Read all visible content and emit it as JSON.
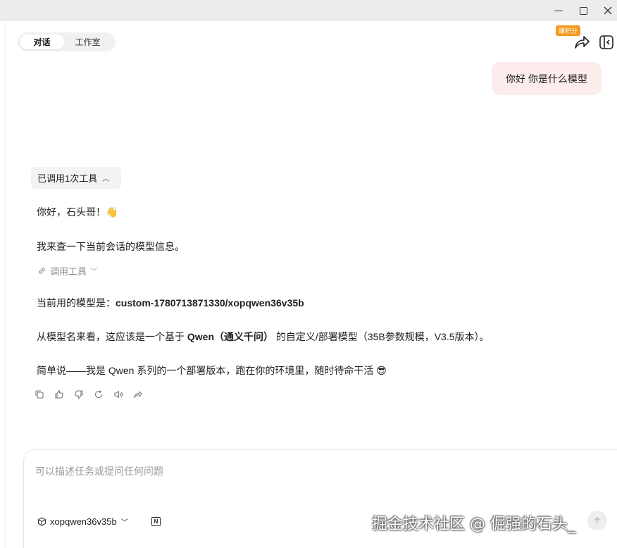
{
  "header": {
    "tabs": [
      {
        "label": "对话",
        "active": true
      },
      {
        "label": "工作室",
        "active": false
      }
    ],
    "earn_badge": "赚积分",
    "icons": {
      "share": "share-icon",
      "sidebar": "sidebar-toggle-icon"
    }
  },
  "window_controls": {
    "minimize": "minimize-icon",
    "maximize": "maximize-icon",
    "close": "close-icon"
  },
  "conversation": {
    "user_message": "你好 你是什么模型",
    "tool_summary": "已调用1次工具",
    "lines": {
      "greeting": "你好，石头哥！👋",
      "checking": "我来查一下当前会话的模型信息。",
      "tool_link": "调用工具",
      "model_prefix": "当前用的模型是：",
      "model_name": "custom-1780713871330/xopqwen36v35b",
      "analysis_prefix": "从模型名来看，这应该是一个基于 ",
      "analysis_bold": "Qwen（通义千问）",
      "analysis_suffix": " 的自定义/部署模型（35B参数规模，V3.5版本）。",
      "summary": "简单说——我是 Qwen 系列的一个部署版本，跑在你的环境里，随时待命干活 😎"
    },
    "actions": [
      "copy-icon",
      "thumbs-up-icon",
      "thumbs-down-icon",
      "refresh-icon",
      "speaker-icon",
      "share-icon"
    ]
  },
  "composer": {
    "placeholder": "可以描述任务或提问任何问题",
    "model": "xopqwen36v35b",
    "watermark": "掘金技术社区 @ 倔强的石头_"
  },
  "colors": {
    "user_bubble": "#fcecec",
    "badge": "#f29a1e",
    "titlebar": "#ececec"
  }
}
